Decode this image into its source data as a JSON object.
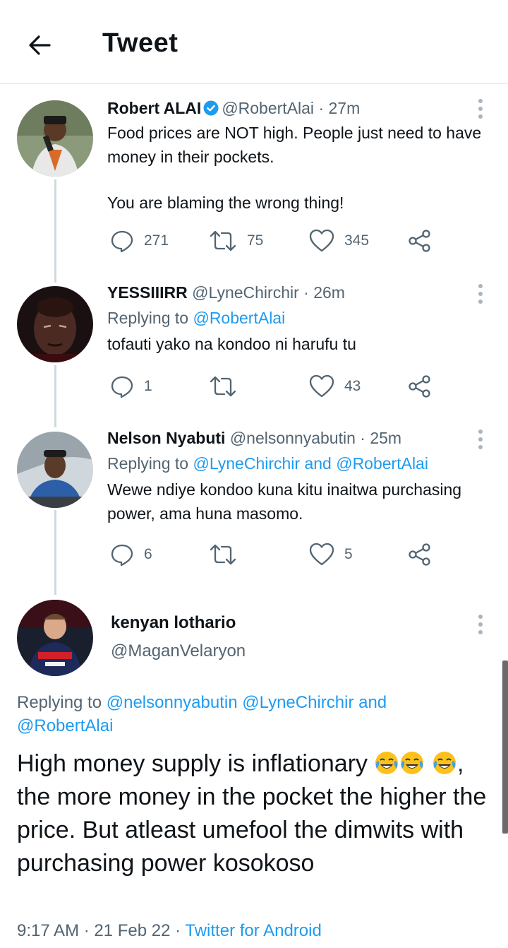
{
  "header": {
    "title": "Tweet",
    "back_icon": "arrow-left-icon"
  },
  "tweets": [
    {
      "name": "Robert ALAI",
      "verified": true,
      "handle": "@RobertAlai",
      "time": "· 27m",
      "paragraphs": [
        "Food prices are NOT high. People just need to have money in their pockets.",
        "You are blaming the wrong thing!"
      ],
      "replies": "271",
      "retweets": "75",
      "likes": "345"
    },
    {
      "name": "YESSIIIRR",
      "handle": "@LyneChirchir",
      "time": "· 26m",
      "replying_prefix": "Replying to",
      "replying_to": "@RobertAlai",
      "paragraphs": [
        "tofauti yako na kondoo ni harufu tu"
      ],
      "replies": "1",
      "retweets": "",
      "likes": "43"
    },
    {
      "name": "Nelson Nyabuti",
      "handle": "@nelsonnyabutin",
      "time": "· 25m",
      "replying_prefix": "Replying to",
      "replying_to": "@LyneChirchir and @RobertAlai",
      "paragraphs": [
        "Wewe ndiye kondoo kuna kitu inaitwa purchasing power, ama huna masomo."
      ],
      "replies": "6",
      "retweets": "",
      "likes": "5"
    }
  ],
  "main_tweet": {
    "name": "kenyan lothario",
    "handle": "@MaganVelaryon",
    "replying_prefix": "Replying to",
    "replying_to_line1": "@nelsonnyabutin @LyneChirchir and",
    "replying_to_line2": "@RobertAlai",
    "text_part1": "High money supply is inflationary",
    "text_part2": ", the more money in the pocket the higher the price. But atleast umefool the dimwits with purchasing power kosokoso",
    "emoji": "face-with-tears-of-joy",
    "time": "9:17 AM",
    "date": "21 Feb 22",
    "source": "Twitter for Android"
  },
  "colors": {
    "accent": "#1d9bf0",
    "text": "#0f1419",
    "secondary": "#536471",
    "divider": "#dfe6ea"
  }
}
